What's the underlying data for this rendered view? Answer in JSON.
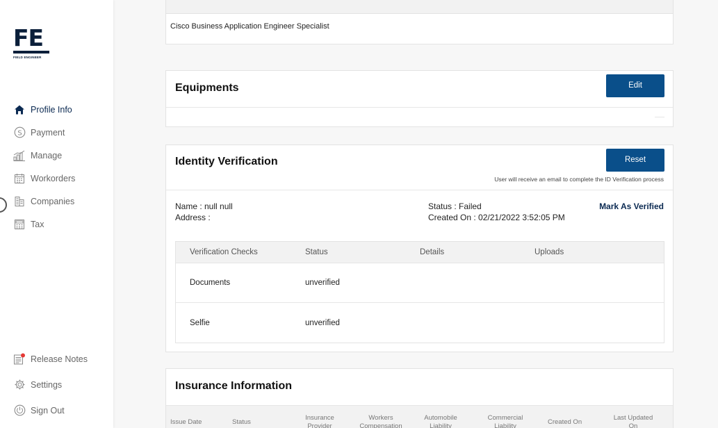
{
  "brand": {
    "mark": "FE",
    "sub": "FIELD ENGINEER"
  },
  "nav": [
    {
      "label": "Profile Info",
      "icon": "home-icon"
    },
    {
      "label": "Payment",
      "icon": "dollar-circle-icon"
    },
    {
      "label": "Manage",
      "icon": "bar-chart-icon"
    },
    {
      "label": "Workorders",
      "icon": "calendar-icon"
    },
    {
      "label": "Companies",
      "icon": "building-icon"
    },
    {
      "label": "Tax",
      "icon": "calculator-icon"
    }
  ],
  "nav_bottom": [
    {
      "label": "Release Notes",
      "icon": "document-badge-icon"
    },
    {
      "label": "Settings",
      "icon": "gear-icon"
    },
    {
      "label": "Sign Out",
      "icon": "power-icon"
    }
  ],
  "skills_card": {
    "text": "Cisco Business Application Engineer Specialist"
  },
  "equipments": {
    "title": "Equipments",
    "edit_label": "Edit"
  },
  "identity": {
    "title": "Identity Verification",
    "reset_label": "Reset",
    "note": "User will receive an email to complete the ID Verification process",
    "name": "Name : null null",
    "address": "Address :",
    "status": "Status : Failed",
    "created": "Created On : 02/21/2022 3:52:05 PM",
    "mark_verified": "Mark As Verified",
    "table": {
      "headers": [
        "Verification Checks",
        "Status",
        "Details",
        "Uploads"
      ],
      "rows": [
        {
          "check": "Documents",
          "status": "unverified"
        },
        {
          "check": "Selfie",
          "status": "unverified"
        }
      ]
    }
  },
  "insurance": {
    "title": "Insurance Information",
    "headers": [
      "Issue Date",
      "Status",
      "Insurance Provider",
      "Workers Compensation",
      "Automobile Liability",
      "Commercial Liability",
      "Created On",
      "Last Updated On"
    ]
  },
  "colors": {
    "primary": "#0a4f8a",
    "navy": "#0b2a52",
    "notify": "#e53935"
  }
}
